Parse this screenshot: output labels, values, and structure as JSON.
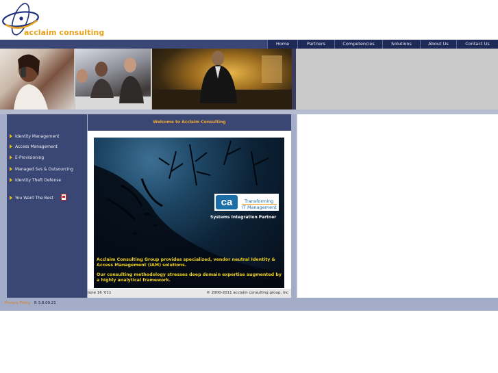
{
  "brand": {
    "name": "acclaim consulting"
  },
  "nav": {
    "items": [
      "Home",
      "Partners",
      "Competencies",
      "Solutions",
      "About Us",
      "Contact Us"
    ]
  },
  "sidebar": {
    "items": [
      "Identity Management",
      "Access Management",
      "E-Provisioning",
      "Managed Svs & Outsourcing",
      "Identity Theft Defense",
      "You Want The Best"
    ],
    "pdf_icon": "pdf-icon"
  },
  "content": {
    "welcome": "Welcome to Acclaim Consulting",
    "ca_logo": "ca",
    "ca_tagline_1": "Transforming",
    "ca_tagline_2": "IT Management",
    "partner": "Systems Integration Partner",
    "paragraph_1": "Acclaim Consulting Group provides specialized, vendor neutral Identity & Access Management (IAM) solutions.",
    "paragraph_2": "Our consulting methodology stresses deep domain expertise augmented by a highly analytical framework.",
    "date": "June 16 '011",
    "copyright": "© 2000-2011 acclaim consulting group, inc"
  },
  "footer": {
    "privacy": "Privacy Policy",
    "version": "R 3.8.09.21"
  },
  "colors": {
    "navy": "#3a4674",
    "accent": "#e8a21c",
    "hero_text": "#f2d21a"
  }
}
